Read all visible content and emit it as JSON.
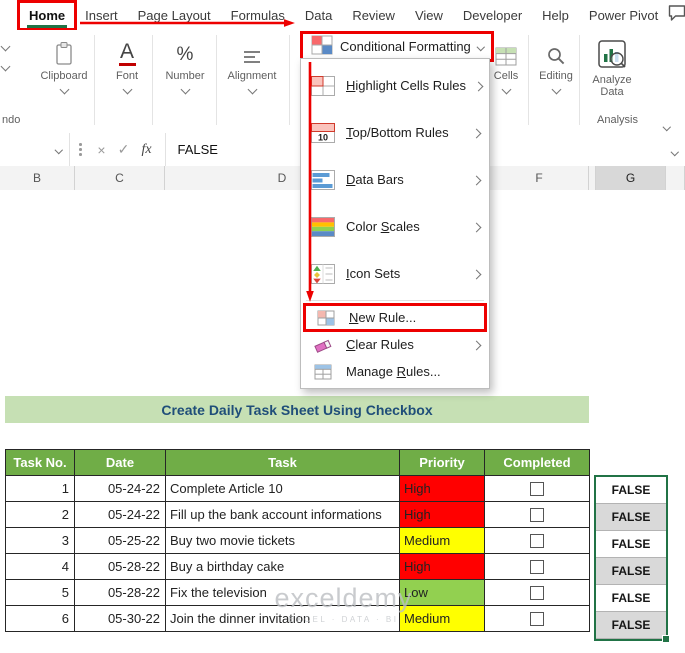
{
  "tabs": [
    {
      "label": "Home",
      "active": true
    },
    {
      "label": "Insert"
    },
    {
      "label": "Page Layout"
    },
    {
      "label": "Formulas"
    },
    {
      "label": "Data"
    },
    {
      "label": "Review"
    },
    {
      "label": "View"
    },
    {
      "label": "Developer"
    },
    {
      "label": "Help"
    },
    {
      "label": "Power Pivot"
    }
  ],
  "ribbon": {
    "groups": [
      "Clipboard",
      "Font",
      "Number",
      "Alignment"
    ],
    "conditional_formatting": "Conditional Formatting",
    "cells": "Cells",
    "editing": "Editing",
    "analyze_data": "Analyze Data",
    "analysis": "Analysis",
    "undo_partial": "ndo"
  },
  "formula_bar": {
    "value": "FALSE",
    "fx": "fx",
    "cancel": "×",
    "enter": "✓"
  },
  "columns": [
    "B",
    "C",
    "D",
    "F",
    "G"
  ],
  "menu": {
    "items": [
      {
        "label": "Highlight Cells Rules",
        "accel_index": 0,
        "submenu": true,
        "icon": "highlight-cells"
      },
      {
        "label": "Top/Bottom Rules",
        "accel_index": 0,
        "submenu": true,
        "icon": "top-bottom"
      },
      {
        "label": "Data Bars",
        "accel_index": 0,
        "submenu": true,
        "icon": "data-bars"
      },
      {
        "label": "Color Scales",
        "accel_index": 6,
        "submenu": true,
        "icon": "color-scales"
      },
      {
        "label": "Icon Sets",
        "accel_index": 0,
        "submenu": true,
        "icon": "icon-sets"
      }
    ],
    "bottom_items": [
      {
        "label": "New Rule...",
        "accel_index": 0,
        "icon": "new-rule",
        "boxed": true
      },
      {
        "label": "Clear Rules",
        "accel_index": 0,
        "submenu": true,
        "icon": "clear-rules"
      },
      {
        "label": "Manage Rules...",
        "accel_index": 7,
        "icon": "manage-rules"
      }
    ]
  },
  "sheet": {
    "title": "Create Daily Task Sheet Using Checkbox",
    "table": {
      "headers": [
        "Task No.",
        "Date",
        "Task",
        "Priority",
        "Completed"
      ],
      "rows": [
        {
          "no": "1",
          "date": "05-24-22",
          "task": "Complete Article 10",
          "priority": "High",
          "completed": false,
          "formula": "FALSE"
        },
        {
          "no": "2",
          "date": "05-24-22",
          "task": "Fill up the bank account informations",
          "priority": "High",
          "completed": false,
          "formula": "FALSE"
        },
        {
          "no": "3",
          "date": "05-25-22",
          "task": "Buy two movie tickets",
          "priority": "Medium",
          "completed": false,
          "formula": "FALSE"
        },
        {
          "no": "4",
          "date": "05-28-22",
          "task": "Buy a birthday cake",
          "priority": "High",
          "completed": false,
          "formula": "FALSE"
        },
        {
          "no": "5",
          "date": "05-28-22",
          "task": "Fix the television",
          "priority": "Low",
          "completed": false,
          "formula": "FALSE"
        },
        {
          "no": "6",
          "date": "05-30-22",
          "task": "Join the dinner invitation",
          "priority": "Medium",
          "completed": false,
          "formula": "FALSE"
        }
      ]
    },
    "watermark": {
      "big": "exceldemy",
      "small": "EXCEL · DATA · BI"
    }
  },
  "colors": {
    "excel_green": "#217346",
    "annotation_red": "#ED0000",
    "table_header_green": "#70AD47",
    "title_banner_bg": "#C6E0B4",
    "title_text": "#1F4E79",
    "selection_gray": "#D9D9D9",
    "priority": {
      "High": "#FF0000",
      "Medium": "#FFFF00",
      "Low": "#92D050"
    }
  }
}
